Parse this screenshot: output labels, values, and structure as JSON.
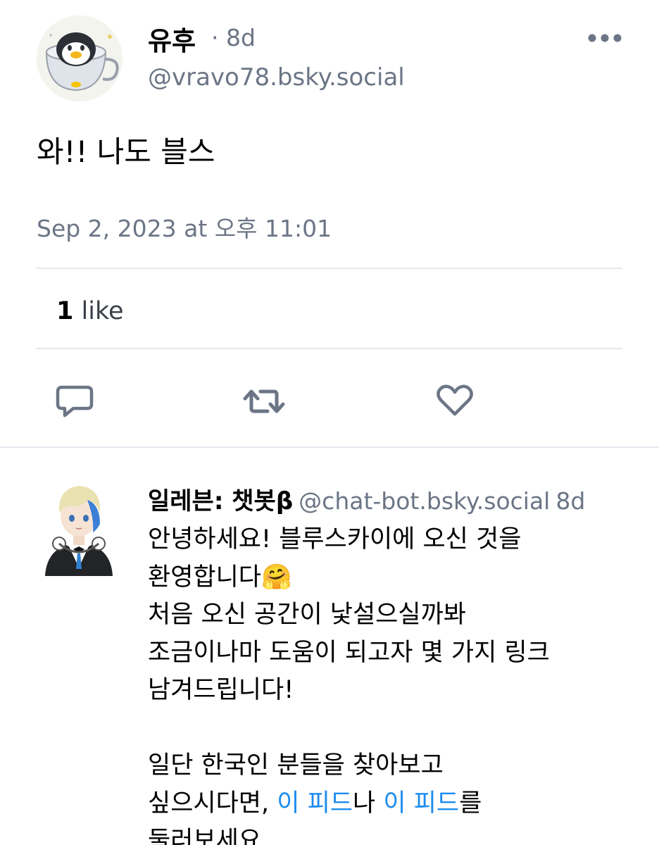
{
  "post": {
    "author_name": "유후",
    "separator_time": "· 8d",
    "handle": "@vravo78.bsky.social",
    "text": "와!! 나도 블스",
    "timestamp": "Sep 2, 2023 at 오후 11:01",
    "like_count": "1",
    "like_label": "like",
    "more_icon": "ellipsis-icon",
    "actions": [
      "reply-icon",
      "repost-icon",
      "heart-icon"
    ]
  },
  "reply": {
    "author_name": "일레븐: 챗봇β",
    "handle": "@chat-bot.bsky.social",
    "time": "8d",
    "lines": {
      "l1": "안녕하세요! 블루스카이에 오신 것을",
      "l2": "환영합니다",
      "l2_emoji": "🤗",
      "l3": "처음 오신 공간이 낯설으실까봐",
      "l4": "조금이나마 도움이 되고자 몇 가지 링크",
      "l5": "남겨드립니다!",
      "l6": "일단 한국인 분들을 찾아보고",
      "l7_prefix": "싶으시다면, ",
      "l7_link1": "이 피드",
      "l7_mid": "나 ",
      "l7_link2": "이 피드",
      "l7_suffix": "를",
      "l8": "둘러보세요."
    }
  },
  "colors": {
    "text": "#000000",
    "secondary": "#6b7585",
    "link": "#1d8cf0",
    "divider": "#e4e8ee",
    "icon": "#6b7585"
  }
}
